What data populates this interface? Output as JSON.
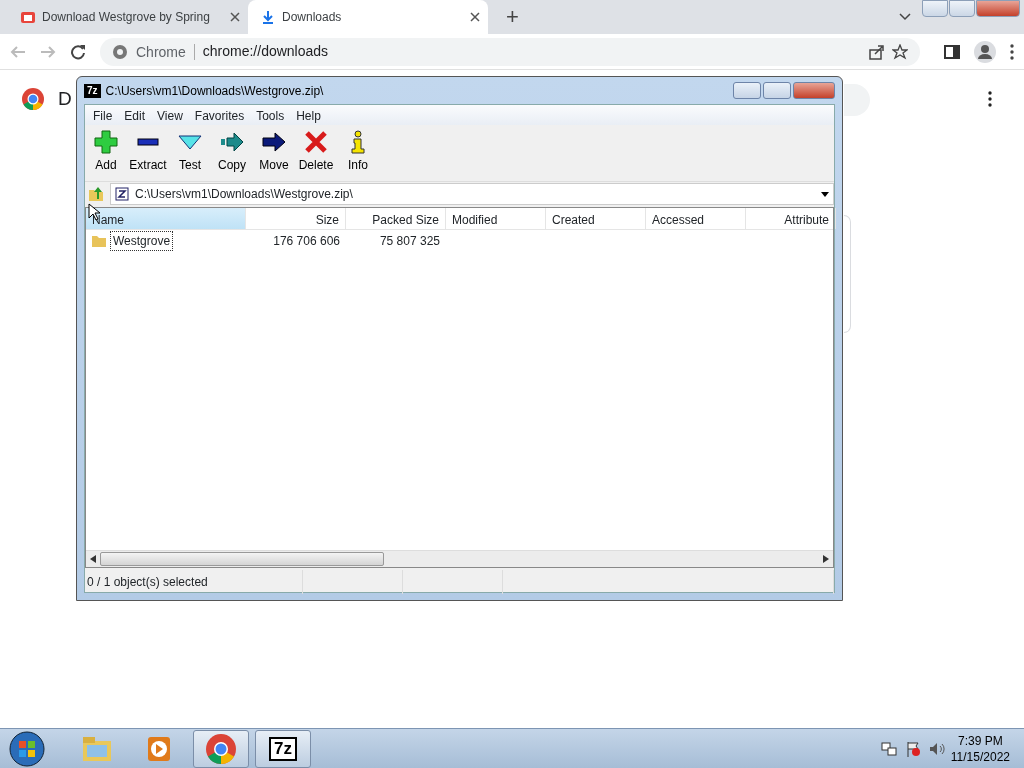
{
  "browser": {
    "tabs": [
      {
        "title": "Download Westgrove by Spring",
        "kind": "site",
        "selected": false
      },
      {
        "title": "Downloads",
        "kind": "download",
        "selected": true
      }
    ],
    "new_tab": "+",
    "omnibox": {
      "site": "Chrome",
      "url": "chrome://downloads"
    }
  },
  "page": {
    "heading": "D"
  },
  "archiver": {
    "icon": "7z",
    "title": "C:\\Users\\vm1\\Downloads\\Westgrove.zip\\",
    "menu": [
      "File",
      "Edit",
      "View",
      "Favorites",
      "Tools",
      "Help"
    ],
    "toolbar": [
      {
        "label": "Add",
        "kind": "add"
      },
      {
        "label": "Extract",
        "kind": "extract"
      },
      {
        "label": "Test",
        "kind": "test"
      },
      {
        "label": "Copy",
        "kind": "copy"
      },
      {
        "label": "Move",
        "kind": "move"
      },
      {
        "label": "Delete",
        "kind": "delete"
      },
      {
        "label": "Info",
        "kind": "info"
      }
    ],
    "address": "C:\\Users\\vm1\\Downloads\\Westgrove.zip\\",
    "columns": [
      "Name",
      "Size",
      "Packed Size",
      "Modified",
      "Created",
      "Accessed",
      "Attribute"
    ],
    "rows": [
      {
        "name": "Westgrove",
        "size": "176 706 606",
        "packed_size": "75 807 325"
      }
    ],
    "status": "0 / 1 object(s) selected"
  },
  "taskbar": {
    "items": [
      {
        "kind": "folder",
        "active": false
      },
      {
        "kind": "media",
        "active": false
      },
      {
        "kind": "chrome",
        "active": true
      },
      {
        "kind": "archiver",
        "label": "7z",
        "active": true
      }
    ],
    "time": "7:39 PM",
    "date": "11/15/2022"
  }
}
